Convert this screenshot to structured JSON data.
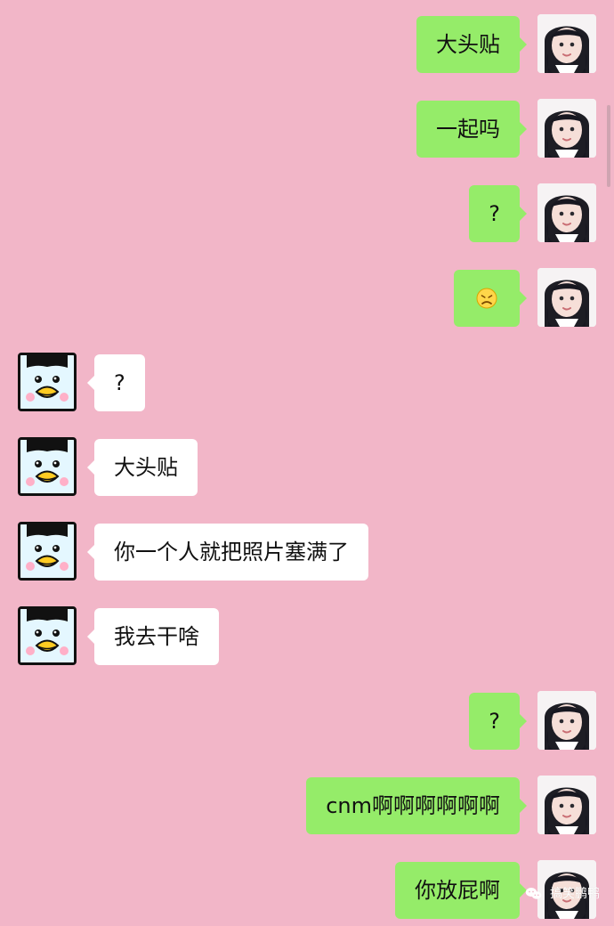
{
  "chat": {
    "messages": [
      {
        "side": "right",
        "type": "text",
        "text": "大头贴",
        "avatar_icon": "girl-avatar-icon"
      },
      {
        "side": "right",
        "type": "text",
        "text": "一起吗",
        "avatar_icon": "girl-avatar-icon"
      },
      {
        "side": "right",
        "type": "text",
        "text": "?",
        "avatar_icon": "girl-avatar-icon"
      },
      {
        "side": "right",
        "type": "emoji",
        "emoji_icon": "sad-face-emoji-icon",
        "avatar_icon": "girl-avatar-icon"
      },
      {
        "side": "left",
        "type": "text",
        "text": "?",
        "avatar_icon": "penguin-avatar-icon"
      },
      {
        "side": "left",
        "type": "text",
        "text": "大头贴",
        "avatar_icon": "penguin-avatar-icon"
      },
      {
        "side": "left",
        "type": "text",
        "text": "你一个人就把照片塞满了",
        "avatar_icon": "penguin-avatar-icon"
      },
      {
        "side": "left",
        "type": "text",
        "text": "我去干啥",
        "avatar_icon": "penguin-avatar-icon"
      },
      {
        "side": "right",
        "type": "text",
        "text": "?",
        "avatar_icon": "girl-avatar-icon"
      },
      {
        "side": "right",
        "type": "text",
        "text": "cnm啊啊啊啊啊啊",
        "avatar_icon": "girl-avatar-icon"
      },
      {
        "side": "right",
        "type": "text",
        "text": "你放屁啊",
        "avatar_icon": "girl-avatar-icon"
      }
    ]
  },
  "watermark": {
    "icon": "wechat-icon",
    "text": "搞笑鹏鸭"
  },
  "colors": {
    "background": "#f2b6c8",
    "right_bubble": "#95ec69",
    "left_bubble": "#ffffff"
  }
}
